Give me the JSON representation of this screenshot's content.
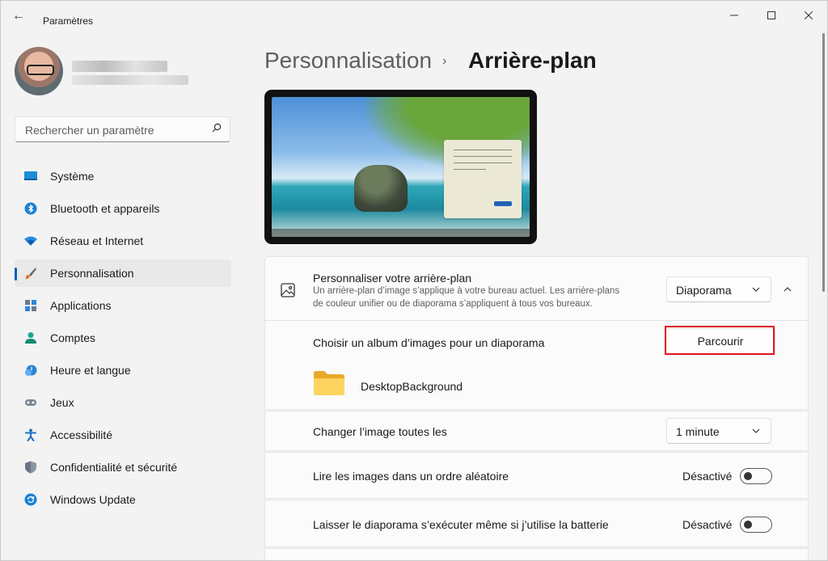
{
  "window": {
    "title": "Paramètres",
    "back_icon": "back-arrow-icon",
    "minimize_glyph": "—",
    "maximize_glyph": "☐",
    "close_glyph": "✕"
  },
  "search": {
    "placeholder": "Rechercher un paramètre"
  },
  "sidebar": {
    "items": [
      {
        "label": "Système",
        "icon": "system-icon"
      },
      {
        "label": "Bluetooth et appareils",
        "icon": "bluetooth-icon"
      },
      {
        "label": "Réseau et Internet",
        "icon": "network-icon"
      },
      {
        "label": "Personnalisation",
        "icon": "brush-icon",
        "active": true
      },
      {
        "label": "Applications",
        "icon": "apps-icon"
      },
      {
        "label": "Comptes",
        "icon": "accounts-icon"
      },
      {
        "label": "Heure et langue",
        "icon": "time-language-icon"
      },
      {
        "label": "Jeux",
        "icon": "gaming-icon"
      },
      {
        "label": "Accessibilité",
        "icon": "accessibility-icon"
      },
      {
        "label": "Confidentialité et sécurité",
        "icon": "shield-icon"
      },
      {
        "label": "Windows Update",
        "icon": "windows-update-icon"
      }
    ]
  },
  "breadcrumb": {
    "parent": "Personnalisation",
    "separator": "›",
    "current": "Arrière-plan"
  },
  "background_settings": {
    "title": "Personnaliser votre arrière-plan",
    "description_line1": "Un arrière-plan d’image s’applique à votre bureau actuel. Les arrière-plans",
    "description_line2": "de couleur unifier ou de diaporama s’appliquent à tous vos bureaux.",
    "type_value": "Diaporama",
    "album_label": "Choisir un album d’images pour un diaporama",
    "browse_label": "Parcourir",
    "folder_name": "DesktopBackground",
    "interval_label": "Changer l’image toutes les",
    "interval_value": "1 minute",
    "shuffle_label": "Lire les images dans un ordre aléatoire",
    "shuffle_state": "Désactivé",
    "battery_label": "Laisser le diaporama s’exécuter même si j’utilise la batterie",
    "battery_state": "Désactivé"
  },
  "colors": {
    "accent": "#005fb8",
    "highlight": "#e0141e"
  }
}
